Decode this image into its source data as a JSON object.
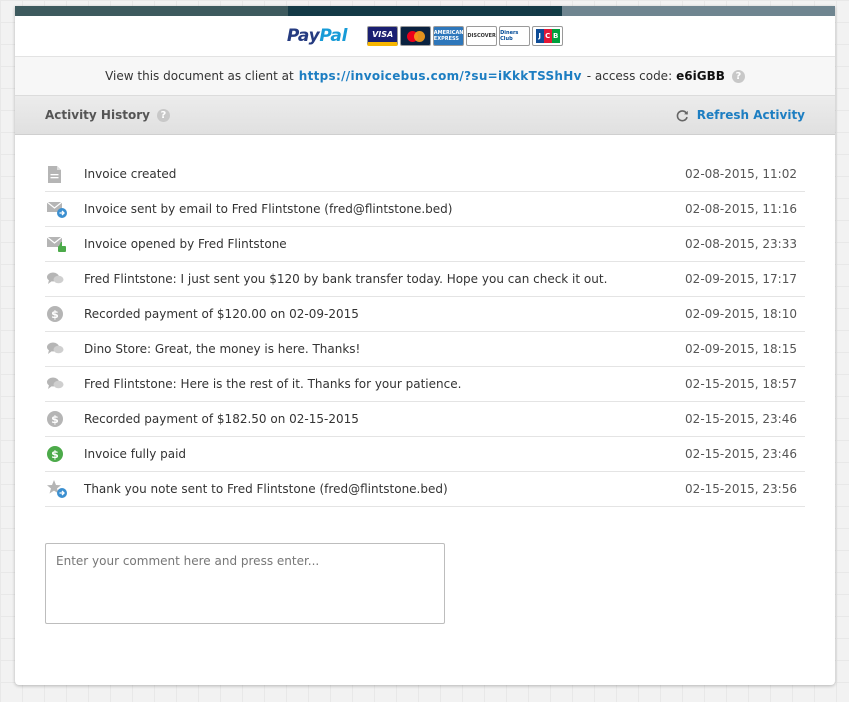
{
  "paypal": {
    "part1": "Pay",
    "part2": "Pal"
  },
  "cards": {
    "visa": "VISA",
    "amex": "AMERICAN EXPRESS",
    "discover": "DISCOVER",
    "diners": "Diners Club",
    "jcb": [
      "J",
      "C",
      "B"
    ]
  },
  "client": {
    "prefix": "View this document as client at",
    "url": "https://invoicebus.com/?su=iKkkTSShHv",
    "access_label": "- access code:",
    "access_code": "e6iGBB",
    "help": "?"
  },
  "history": {
    "title": "Activity History",
    "help": "?",
    "refresh_label": "Refresh Activity",
    "items": [
      {
        "icon": "document-icon",
        "text": "Invoice created",
        "time": "02-08-2015, 11:02"
      },
      {
        "icon": "mail-sent-icon",
        "text": "Invoice sent by email to Fred Flintstone (fred@flintstone.bed)",
        "time": "02-08-2015, 11:16"
      },
      {
        "icon": "mail-opened-icon",
        "text": "Invoice opened by Fred Flintstone",
        "time": "02-08-2015, 23:33"
      },
      {
        "icon": "comment-icon",
        "text": "Fred Flintstone: I just sent you $120 by bank transfer today. Hope you can check it out.",
        "time": "02-09-2015, 17:17"
      },
      {
        "icon": "dollar-icon",
        "text": "Recorded payment of $120.00 on 02-09-2015",
        "time": "02-09-2015, 18:10"
      },
      {
        "icon": "comment-icon",
        "text": "Dino Store: Great, the money is here. Thanks!",
        "time": "02-09-2015, 18:15"
      },
      {
        "icon": "comment-icon",
        "text": "Fred Flintstone: Here is the rest of it. Thanks for your patience.",
        "time": "02-15-2015, 18:57"
      },
      {
        "icon": "dollar-icon",
        "text": "Recorded payment of $182.50 on 02-15-2015",
        "time": "02-15-2015, 23:46"
      },
      {
        "icon": "paid-dollar-icon",
        "text": "Invoice fully paid",
        "time": "02-15-2015, 23:46"
      },
      {
        "icon": "star-sent-icon",
        "text": "Thank you note sent to Fred Flintstone (fred@flintstone.bed)",
        "time": "02-15-2015, 23:56"
      }
    ]
  },
  "comment": {
    "placeholder": "Enter your comment here and press enter...",
    "value": ""
  },
  "colors": {
    "link": "#1d7ec2",
    "bar_dark": "#143a46",
    "bar_mid": "#3d5a5e",
    "bar_light": "#6f8590",
    "paid_green": "#4caa4a",
    "icon_grey": "#b5b5b5",
    "badge_blue": "#3b8fd0"
  }
}
